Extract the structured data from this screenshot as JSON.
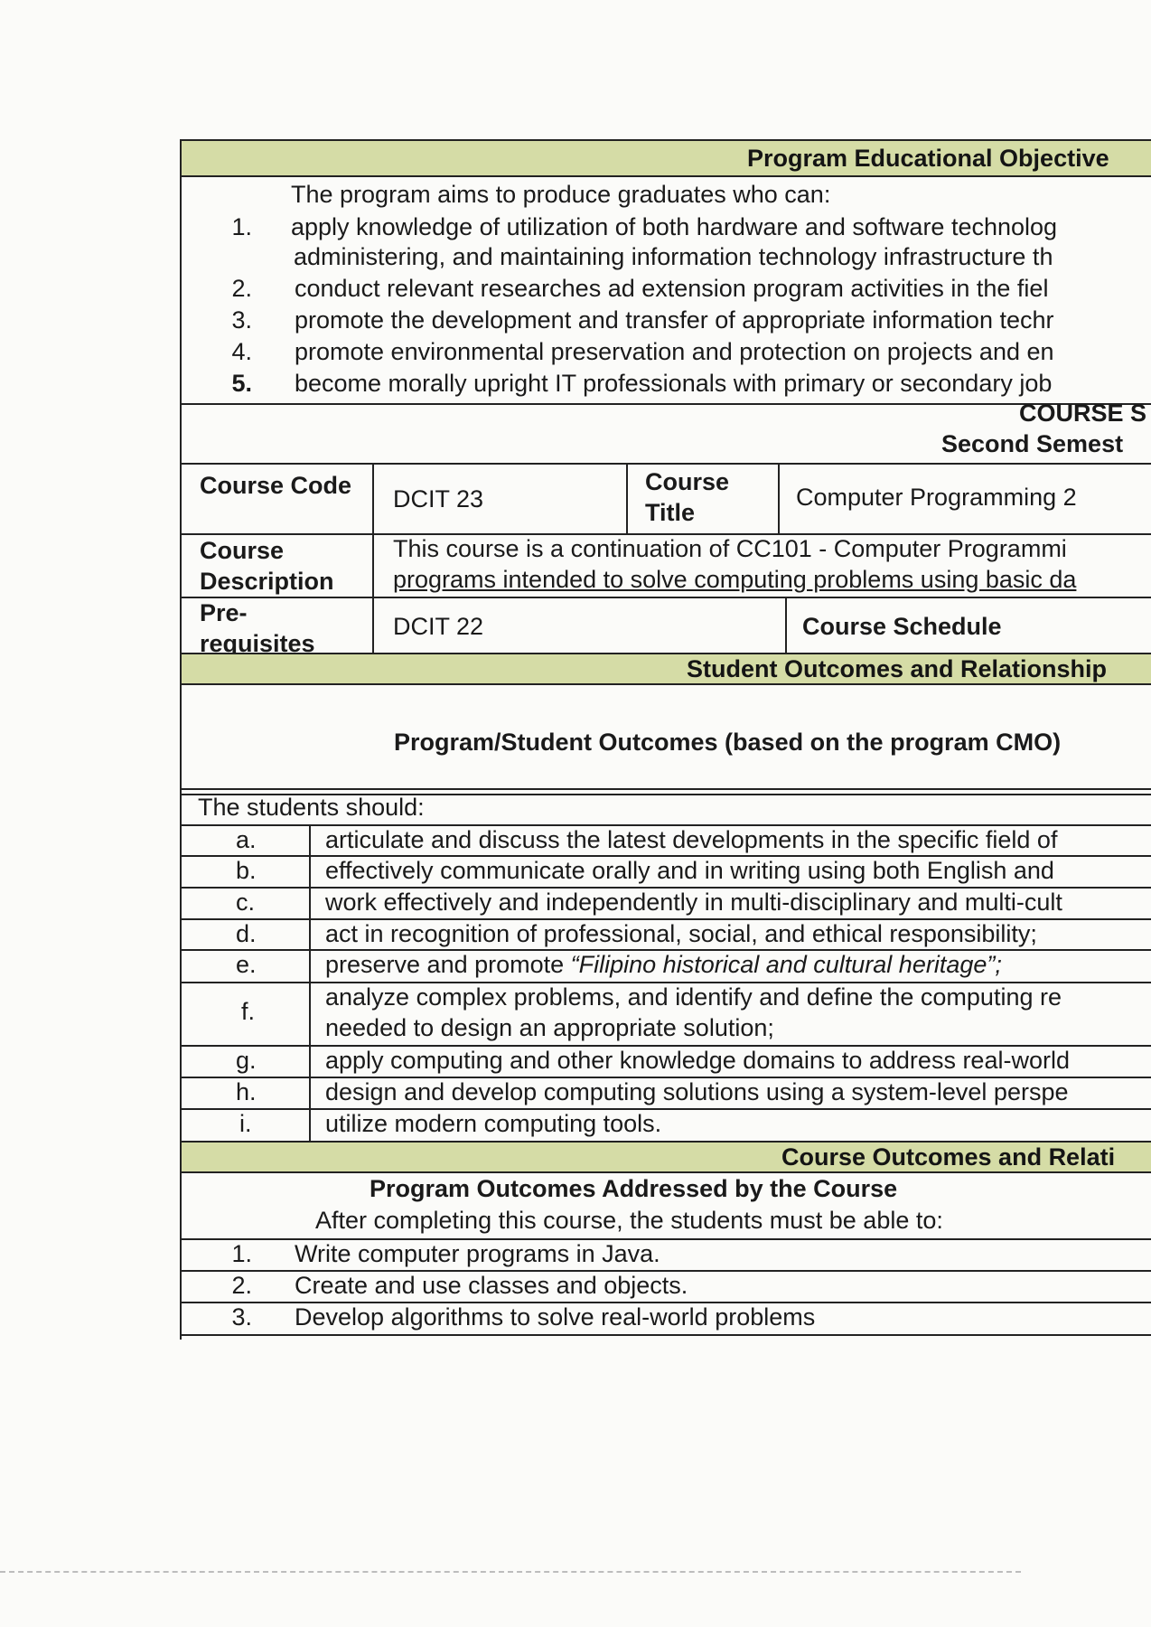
{
  "peo": {
    "band_title": "Program Educational Objective",
    "intro": "The program aims to produce graduates who can:",
    "items": [
      {
        "num": "1.",
        "line1": "apply knowledge of utilization of both hardware and software technolog",
        "line2": "administering, and maintaining information technology infrastructure th"
      },
      {
        "num": "2.",
        "text": "conduct relevant researches ad extension program activities in the fiel"
      },
      {
        "num": "3.",
        "text": "promote the development and transfer of appropriate information techr"
      },
      {
        "num": "4.",
        "text": "promote environmental preservation and protection on projects and en"
      },
      {
        "num": "5.",
        "text": "become morally upright IT professionals with primary or secondary job"
      }
    ]
  },
  "course_header": {
    "title": "COURSE S",
    "semester": "Second Semest"
  },
  "course_info": {
    "code_label": "Course Code",
    "code_value": "DCIT 23",
    "title_label": "Course Title",
    "title_value": "Computer Programming 2",
    "desc_label": "Course Description",
    "desc_line1": "This course is a continuation of CC101 - Computer Programmi",
    "desc_line2": "programs intended to solve computing problems using basic da",
    "prereq_label": "Pre-requisites",
    "prereq_value": "DCIT 22",
    "schedule_label": "Course Schedule"
  },
  "student_outcomes": {
    "band_title": "Student Outcomes and Relationship",
    "heading": "Program/Student Outcomes (based on the program CMO)",
    "intro": "The students should:",
    "items": [
      {
        "letter": "a.",
        "text": "articulate and discuss the latest developments in the specific field of"
      },
      {
        "letter": "b.",
        "text": "effectively communicate orally and in writing using both English and"
      },
      {
        "letter": "c.",
        "text": "work effectively and independently in multi-disciplinary and multi-cult"
      },
      {
        "letter": "d.",
        "text": "act in recognition of professional, social, and ethical responsibility;"
      },
      {
        "letter": "e.",
        "text_pre": "preserve and promote ",
        "text_em": "“Filipino historical and cultural heritage”;"
      },
      {
        "letter": "f.",
        "line1": "analyze complex problems, and identify and define the computing re",
        "line2": "needed to design an appropriate solution;"
      },
      {
        "letter": "g.",
        "text": "apply computing and other knowledge domains to address real-world"
      },
      {
        "letter": "h.",
        "text": "design and develop computing solutions using a system-level perspe"
      },
      {
        "letter": "i.",
        "text": "utilize modern computing tools."
      }
    ]
  },
  "course_outcomes": {
    "band_title": "Course Outcomes and Relati",
    "heading": "Program Outcomes Addressed by the Course",
    "intro": "After completing this course, the students must be able to:",
    "items": [
      {
        "num": "1.",
        "text": "Write computer programs in Java."
      },
      {
        "num": "2.",
        "text": "Create and use classes and objects."
      },
      {
        "num": "3.",
        "text": "Develop algorithms to solve real-world problems"
      }
    ]
  }
}
